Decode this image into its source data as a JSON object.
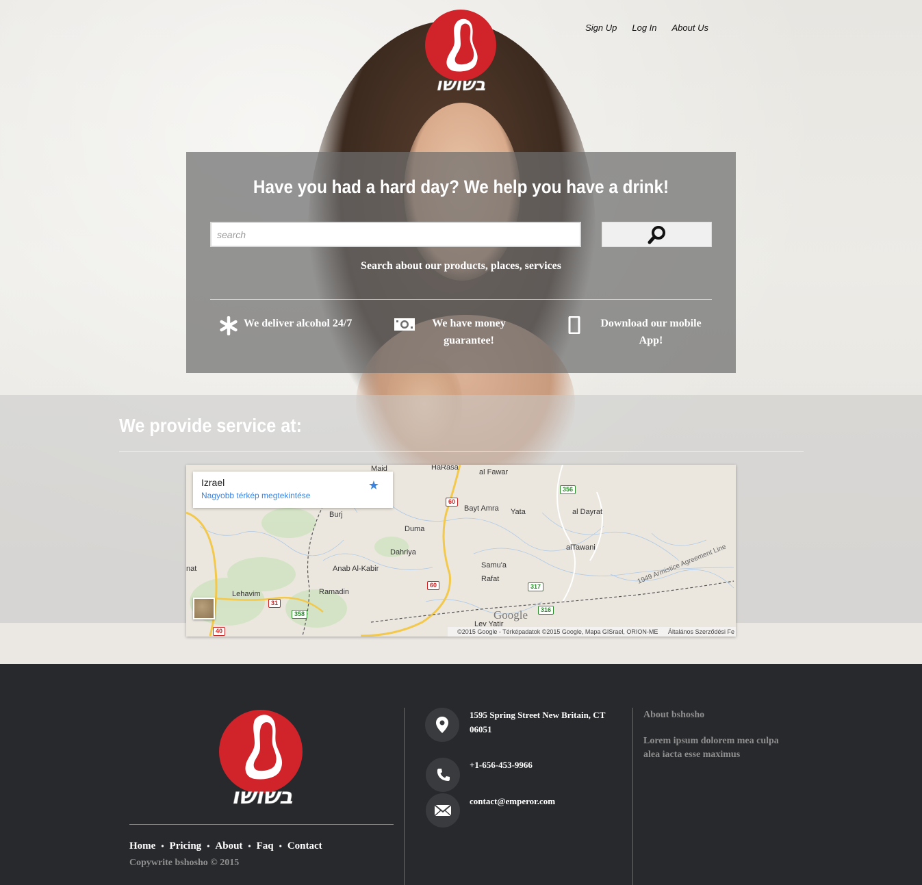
{
  "brand": {
    "name": "bshosho",
    "logo_text": "בשושו",
    "accent": "#d0232a"
  },
  "nav": {
    "items": [
      {
        "label": "Sign Up"
      },
      {
        "label": "Log In"
      },
      {
        "label": "About Us"
      }
    ]
  },
  "hero": {
    "headline": "Have you had a hard day? We help you have a drink!",
    "search": {
      "placeholder": "search",
      "value": "",
      "button_icon": "search-icon"
    },
    "caption": "Search about our products, places, services",
    "features": [
      {
        "icon": "asterisk-icon",
        "text": "We deliver alcohol 24/7"
      },
      {
        "icon": "money-icon",
        "text": "We have money guarantee!"
      },
      {
        "icon": "mobile-icon",
        "text": "Download our mobile App!"
      }
    ]
  },
  "service": {
    "title": "We provide service at:",
    "map": {
      "card_title": "Izrael",
      "card_link": "Nagyobb térkép megtekintése",
      "places": [
        "Maid",
        "HaRasa",
        "al Fawar",
        "Burj",
        "Bayt Amra",
        "Yata",
        "al Dayrat",
        "Duma",
        "Dahriya",
        "alTawani",
        "Anab Al-Kabir",
        "Samu'a",
        "Rafat",
        "nat",
        "Ramadin",
        "Lehavim",
        "Lev Yatir",
        "1949 Armistice Agreement Line"
      ],
      "roads": [
        "356",
        "60",
        "60",
        "317",
        "316",
        "31",
        "358",
        "40"
      ],
      "attribution": "©2015 Google - Térképadatok ©2015 Google, Mapa GISrael, ORION-ME",
      "terms": "Általános Szerződési Fe",
      "google": "Google"
    }
  },
  "footer": {
    "links": [
      {
        "label": "Home"
      },
      {
        "label": "Pricing"
      },
      {
        "label": "About"
      },
      {
        "label": "Faq"
      },
      {
        "label": "Contact"
      }
    ],
    "separator": "•",
    "copyright": "Copywrite bshosho © 2015",
    "contact": {
      "address": "1595 Spring Street New Britain, CT 06051",
      "phone": "+1-656-453-9966",
      "email": "contact@emperor.com"
    },
    "about_title": "About bshosho",
    "about_text": "Lorem ipsum dolorem mea culpa alea iacta esse maximus"
  }
}
